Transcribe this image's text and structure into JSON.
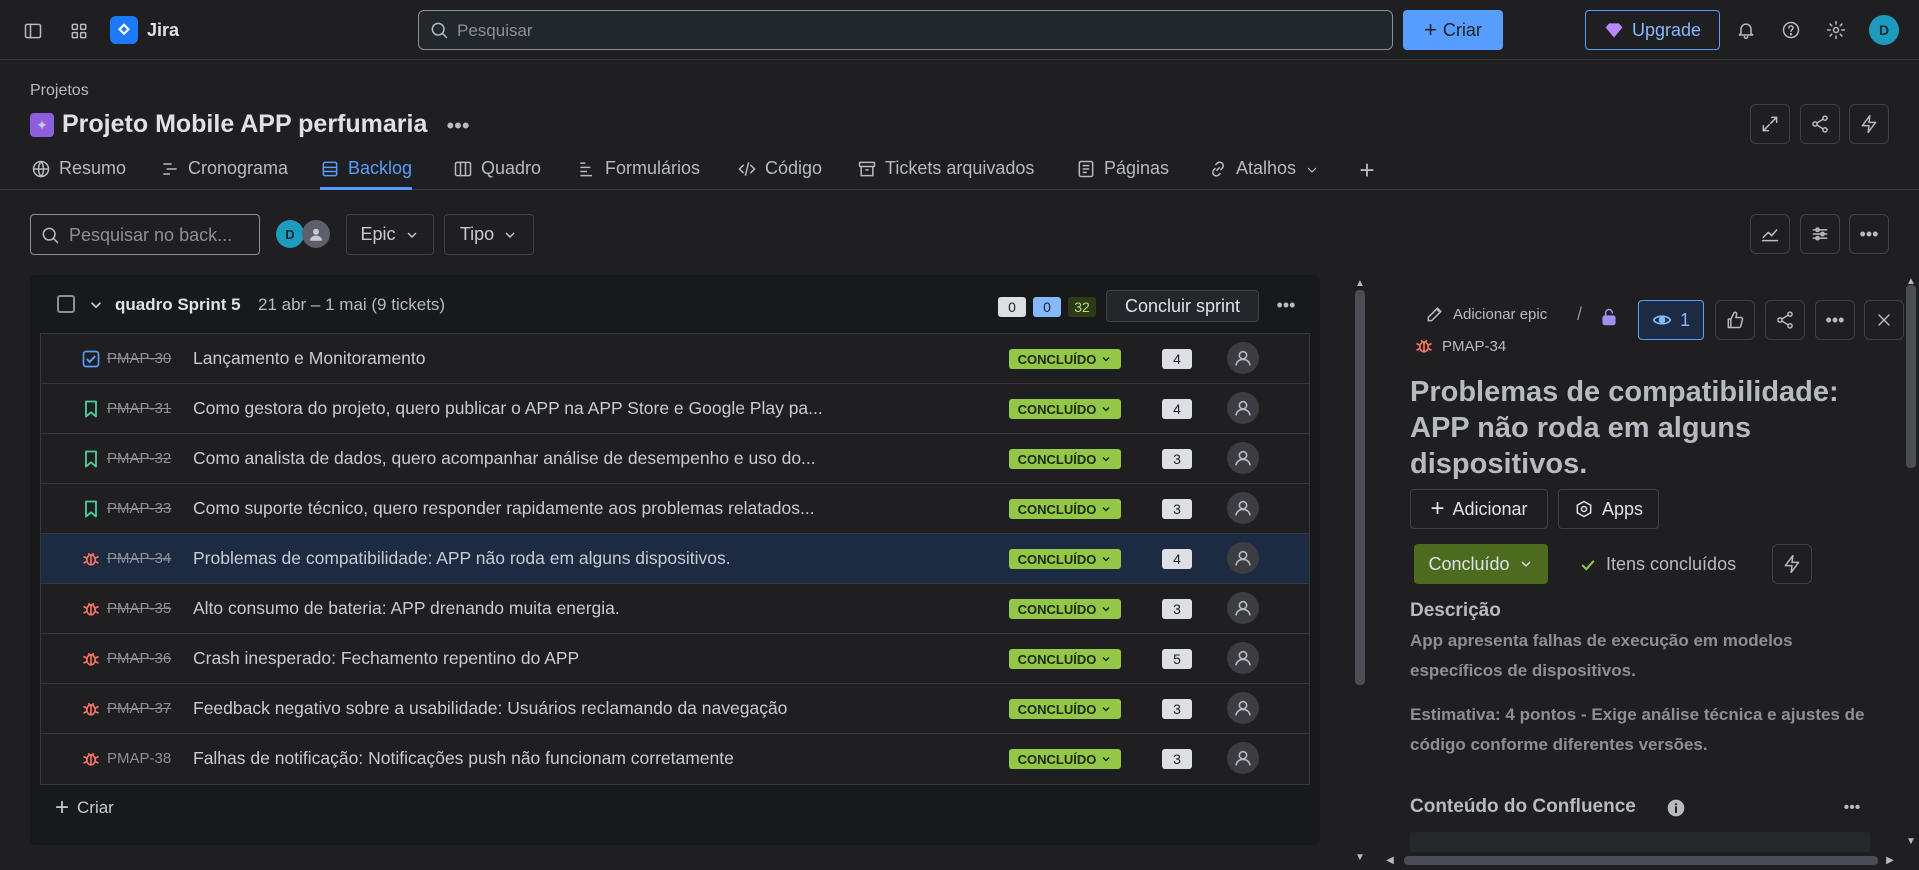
{
  "topbar": {
    "brand": "Jira",
    "search_placeholder": "Pesquisar",
    "create_label": "Criar",
    "upgrade_label": "Upgrade",
    "avatar_initial": "D"
  },
  "project": {
    "breadcrumb": "Projetos",
    "title": "Projeto Mobile APP perfumaria"
  },
  "tabs": [
    {
      "label": "Resumo",
      "icon": "globe-icon"
    },
    {
      "label": "Cronograma",
      "icon": "timeline-icon"
    },
    {
      "label": "Backlog",
      "icon": "backlog-icon",
      "active": true
    },
    {
      "label": "Quadro",
      "icon": "board-icon"
    },
    {
      "label": "Formulários",
      "icon": "forms-icon"
    },
    {
      "label": "Código",
      "icon": "code-icon"
    },
    {
      "label": "Tickets arquivados",
      "icon": "archive-icon"
    },
    {
      "label": "Páginas",
      "icon": "pages-icon"
    },
    {
      "label": "Atalhos",
      "icon": "link-icon"
    }
  ],
  "filters": {
    "search_placeholder": "Pesquisar no back...",
    "avatar_initial": "D",
    "epic_label": "Epic",
    "type_label": "Tipo"
  },
  "sprint": {
    "name": "quadro Sprint 5",
    "dates": "21 abr – 1 mai (9 tickets)",
    "count_todo": "0",
    "count_progress": "0",
    "count_done": "32",
    "complete_label": "Concluir sprint",
    "create_label": "Criar",
    "rows": [
      {
        "type": "task",
        "key": "PMAP-30",
        "summary": "Lançamento e Monitoramento",
        "status": "CONCLUÍDO",
        "estimate": "4"
      },
      {
        "type": "story",
        "key": "PMAP-31",
        "summary": "Como gestora do projeto, quero publicar o APP na APP Store e Google Play pa...",
        "status": "CONCLUÍDO",
        "estimate": "4"
      },
      {
        "type": "story",
        "key": "PMAP-32",
        "summary": "Como analista de dados, quero acompanhar análise de desempenho e uso do...",
        "status": "CONCLUÍDO",
        "estimate": "3"
      },
      {
        "type": "story",
        "key": "PMAP-33",
        "summary": "Como suporte técnico, quero responder rapidamente aos problemas relatados...",
        "status": "CONCLUÍDO",
        "estimate": "3"
      },
      {
        "type": "bug",
        "key": "PMAP-34",
        "summary": "Problemas de compatibilidade: APP não roda em alguns dispositivos.",
        "status": "CONCLUÍDO",
        "estimate": "4",
        "selected": true
      },
      {
        "type": "bug",
        "key": "PMAP-35",
        "summary": "Alto consumo de bateria: APP drenando muita energia.",
        "status": "CONCLUÍDO",
        "estimate": "3"
      },
      {
        "type": "bug",
        "key": "PMAP-36",
        "summary": "Crash inesperado: Fechamento repentino do APP",
        "status": "CONCLUÍDO",
        "estimate": "5"
      },
      {
        "type": "bug",
        "key": "PMAP-37",
        "summary": "Feedback negativo sobre a usabilidade: Usuários reclamando da navegação",
        "status": "CONCLUÍDO",
        "estimate": "3"
      },
      {
        "type": "bug",
        "key": "PMAP-38",
        "summary": "Falhas de notificação: Notificações push não funcionam corretamente",
        "status": "CONCLUÍDO",
        "estimate": "3",
        "nostrike": true
      }
    ]
  },
  "detail": {
    "add_epic_label": "Adicionar epic",
    "watchers": "1",
    "key": "PMAP-34",
    "title": "Problemas de compatibilidade: APP não roda em alguns dispositivos.",
    "add_label": "Adicionar",
    "apps_label": "Apps",
    "status_label": "Concluído",
    "done_items_label": "Itens concluídos",
    "description_heading": "Descrição",
    "description_p1": "App apresenta falhas de execução em modelos específicos de dispositivos.",
    "description_p2": "Estimativa: 4 pontos - Exige análise técnica e ajustes de código conforme diferentes versões.",
    "confluence_heading": "Conteúdo do Confluence"
  },
  "colors": {
    "accent": "#579dff",
    "status_done": "#94c748",
    "bug": "#f87462",
    "story": "#4bce97",
    "task": "#579dff"
  }
}
